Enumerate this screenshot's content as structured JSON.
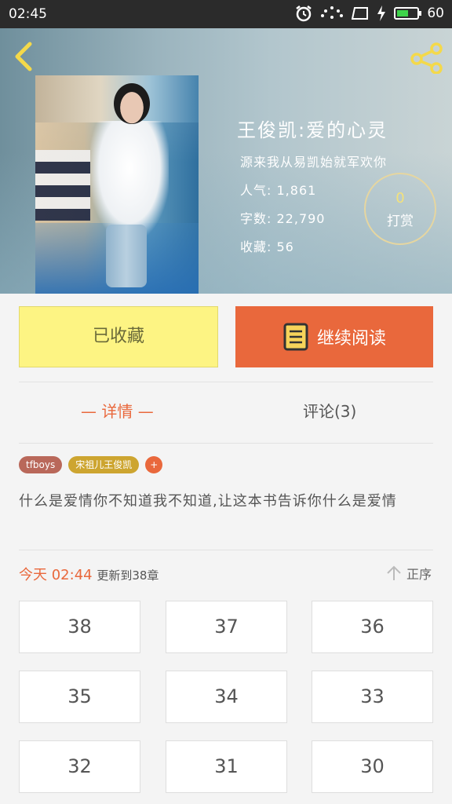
{
  "status_bar": {
    "time": "02:45",
    "battery": "60",
    "battery_fraction": 0.6
  },
  "book": {
    "title": "王俊凯:爱的心灵",
    "author_line": "源来我从易凯始就军欢你",
    "popularity_label": "人气:",
    "popularity": "1,861",
    "word_count_label": "字数:",
    "word_count": "22,790",
    "favorites_label": "收藏:",
    "favorites": "56"
  },
  "reward": {
    "count": "0",
    "label": "打赏"
  },
  "actions": {
    "favorited_label": "已收藏",
    "continue_label": "继续阅读"
  },
  "tabs": {
    "detail": "— 详情 —",
    "comments": "评论(3)"
  },
  "tags": [
    "tfboys",
    "宋祖儿王俊凯",
    "+"
  ],
  "description": "什么是爱情你不知道我不知道,让这本书告诉你什么是爱情",
  "update": {
    "today": "今天",
    "time": "02:44",
    "text": "更新到38章"
  },
  "sort_label": "正序",
  "chapters": [
    "38",
    "37",
    "36",
    "35",
    "34",
    "33",
    "32",
    "31",
    "30"
  ],
  "colors": {
    "accent": "#e9683c",
    "favorite_bg": "#fdf483"
  }
}
